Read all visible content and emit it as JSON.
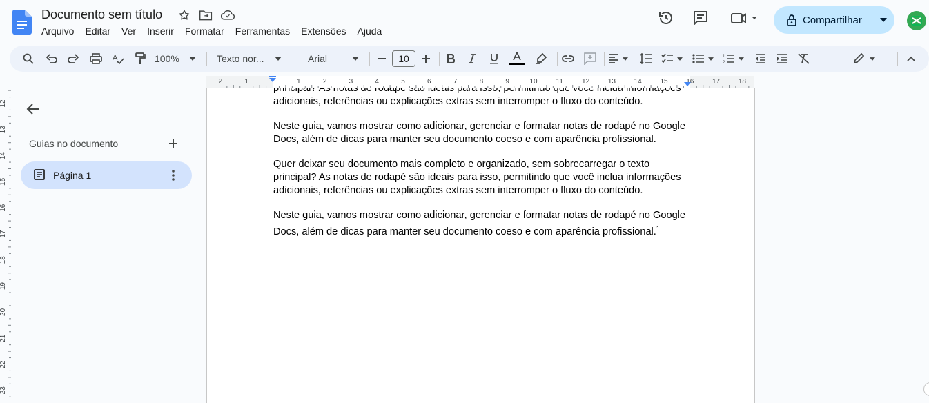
{
  "app": {
    "title": "Documento sem título",
    "accent_color": "#1a73e8",
    "share_bg": "#c2e7ff"
  },
  "menu": [
    "Arquivo",
    "Editar",
    "Ver",
    "Inserir",
    "Formatar",
    "Ferramentas",
    "Extensões",
    "Ajuda"
  ],
  "header": {
    "share_label": "Compartilhar"
  },
  "toolbar": {
    "zoom": "100%",
    "style": "Texto nor...",
    "font": "Arial",
    "font_size": "10",
    "icons": [
      "search-icon",
      "undo-icon",
      "redo-icon",
      "print-icon",
      "spellcheck-icon",
      "paint-format-icon",
      "bold-icon",
      "italic-icon",
      "underline-icon",
      "text-color-icon",
      "highlight-icon",
      "link-icon",
      "comment-add-icon",
      "align-icon",
      "line-spacing-icon",
      "checklist-icon",
      "bullet-list-icon",
      "numbered-list-icon",
      "indent-decrease-icon",
      "indent-increase-icon",
      "clear-format-icon",
      "edit-mode-icon",
      "collapse-icon"
    ]
  },
  "ruler": {
    "h_ticks": [
      "2",
      "1",
      "1",
      "2",
      "3",
      "4",
      "5",
      "6",
      "7",
      "8",
      "9",
      "10",
      "11",
      "12",
      "13",
      "14",
      "15",
      "16",
      "17",
      "18"
    ],
    "v_ticks": [
      "12",
      "13",
      "14",
      "15",
      "16",
      "17",
      "18",
      "19",
      "20",
      "21",
      "22",
      "23"
    ]
  },
  "sidebar": {
    "heading": "Guias no documento",
    "tab_label": "Página 1"
  },
  "document": {
    "paragraphs": [
      "principal? As notas de rodapé são ideais para isso, permitindo que você inclua informações adicionais, referências ou explicações extras sem interromper o fluxo do conteúdo.",
      "Neste guia, vamos mostrar como adicionar, gerenciar e formatar notas de rodapé no Google Docs, além de dicas para manter seu documento coeso e com aparência profissional.",
      "Quer deixar seu documento mais completo e organizado, sem sobrecarregar o texto principal? As notas de rodapé são ideais para isso, permitindo que você inclua informações adicionais, referências ou explicações extras sem interromper o fluxo do conteúdo.",
      "Neste guia, vamos mostrar como adicionar, gerenciar e formatar notas de rodapé no Google Docs, além de dicas para manter seu documento coeso e com aparência profissional."
    ],
    "footnote_mark": "1"
  }
}
